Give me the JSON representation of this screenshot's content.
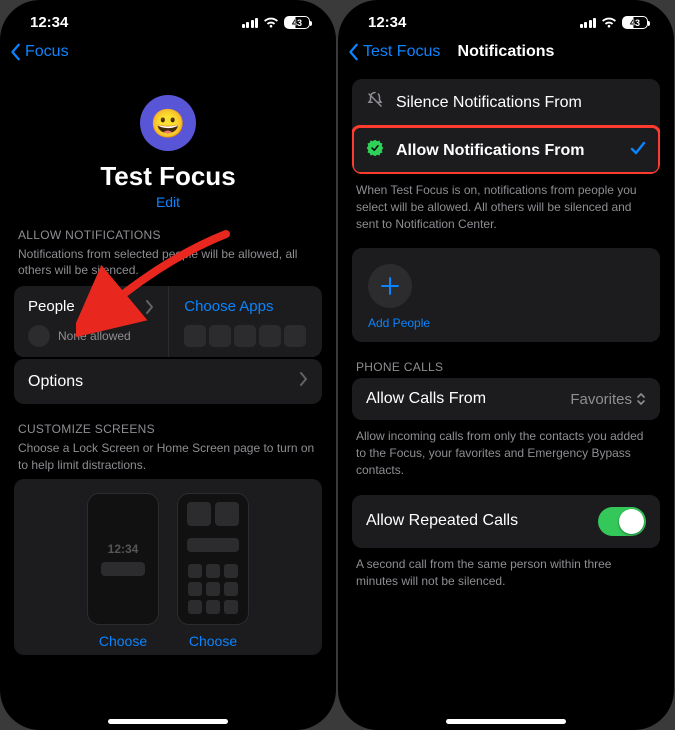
{
  "status": {
    "time": "12:34",
    "battery": "43"
  },
  "left": {
    "back_label": "Focus",
    "focus_name": "Test Focus",
    "edit_label": "Edit",
    "allow_header": "ALLOW NOTIFICATIONS",
    "allow_sub": "Notifications from selected people will be allowed, all others will be silenced.",
    "people_label": "People",
    "none_allowed": "None allowed",
    "choose_apps": "Choose Apps",
    "options_label": "Options",
    "customize_header": "CUSTOMIZE SCREENS",
    "customize_sub": "Choose a Lock Screen or Home Screen page to turn on to help limit distractions.",
    "lock_clock": "12:34",
    "choose_label": "Choose"
  },
  "right": {
    "back_label": "Test Focus",
    "title": "Notifications",
    "silence_label": "Silence Notifications From",
    "allow_label": "Allow Notifications From",
    "allow_note": "When Test Focus is on, notifications from people you select will be allowed. All others will be silenced and sent to Notification Center.",
    "add_people": "Add People",
    "phone_calls_hdr": "PHONE CALLS",
    "allow_calls_label": "Allow Calls From",
    "allow_calls_value": "Favorites",
    "allow_calls_note": "Allow incoming calls from only the contacts you added to the Focus, your favorites and Emergency Bypass contacts.",
    "repeated_label": "Allow Repeated Calls",
    "repeated_note": "A second call from the same person within three minutes will not be silenced."
  },
  "colors": {
    "accent": "#0a84ff",
    "purple": "#5856d6",
    "green": "#34c759",
    "highlight": "#ff3b30"
  }
}
